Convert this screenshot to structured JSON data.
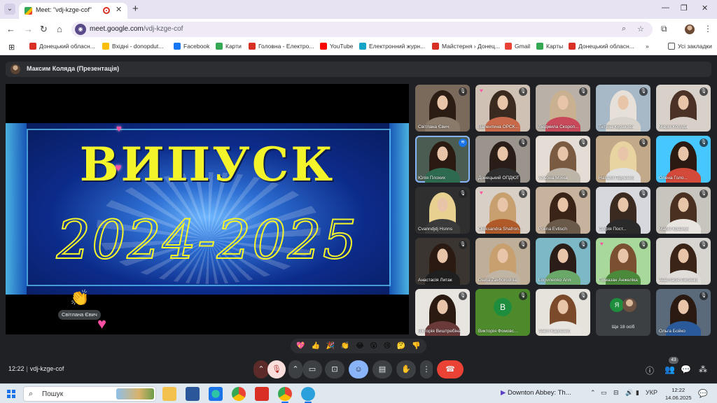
{
  "browser": {
    "tab_title": "Meet: \"vdj-kzge-cof\"",
    "new_tab": "+",
    "url_host": "meet.google.com",
    "url_path": "/vdj-kzge-cof",
    "bookmarks": [
      {
        "label": "Донецький обласн...",
        "color": "#d93025"
      },
      {
        "label": "Вхідні - donopdut...",
        "color": "#fbbc04"
      },
      {
        "label": "Facebook",
        "color": "#1877f2"
      },
      {
        "label": "Карти",
        "color": "#34a853"
      },
      {
        "label": "Головна - Електро...",
        "color": "#d93025"
      },
      {
        "label": "YouTube",
        "color": "#ff0000"
      },
      {
        "label": "Електронний журн...",
        "color": "#12a5c8"
      },
      {
        "label": "Майстерня › Донец...",
        "color": "#d93025"
      },
      {
        "label": "Gmail",
        "color": "#ea4335"
      },
      {
        "label": "Карты",
        "color": "#34a853"
      },
      {
        "label": "Донецький обласн...",
        "color": "#d93025"
      }
    ],
    "bookmarks_more": "»",
    "all_bookmarks": "Усі закладки"
  },
  "meet": {
    "presenter_label": "Максим Коляда (Презентація)",
    "slide": {
      "title": "ВИПУСК",
      "year": "2024-2025"
    },
    "reaction_name": "Світлана Євич",
    "tiles": [
      {
        "name": "Світлана Євич",
        "hair": "#2b1d14",
        "body": "#8a7a6a",
        "bg": "#7a6a5c",
        "mute": true
      },
      {
        "name": "Валентина ОРСК...",
        "hair": "#3a2a20",
        "body": "#c86a4a",
        "bg": "#cfc2b4",
        "mute": true,
        "heart": true
      },
      {
        "name": "Людмила Скороп...",
        "hair": "#c9b090",
        "body": "#c84a5a",
        "bg": "#b9b0a8",
        "mute": true
      },
      {
        "name": "Тетяна Куракова",
        "hair": "#e6e0d8",
        "body": "#d8d4cc",
        "bg": "#a7b8c6",
        "mute": true
      },
      {
        "name": "Марія Коляда",
        "hair": "#4a3326",
        "body": "#d8d0c8",
        "bg": "#d7d1c9",
        "mute": true
      },
      {
        "name": "Юлія Плохих",
        "hair": "#2a1a12",
        "body": "#2d6a4f",
        "bg": "#4b5d52",
        "speaking": true
      },
      {
        "name": "Донецький ОПДЮТ",
        "hair": "#2a1d18",
        "body": "#2f2f2f",
        "bg": "#9a948c",
        "mute": true
      },
      {
        "name": "Альона Міхна",
        "hair": "#7a5a40",
        "body": "#bdb5a8",
        "bg": "#e3ddd5",
        "mute": true
      },
      {
        "name": "Наталя Підченко",
        "hair": "#e8d4a0",
        "body": "#e0e0e0",
        "bg": "#c2a98a",
        "mute": true
      },
      {
        "name": "Олена Голо...",
        "hair": "#2a1a12",
        "body": "#d34a3a",
        "bg": "#47c7ff",
        "mute": true
      },
      {
        "name": "Сvanndjdj Hsnns",
        "hair": "#e8d090",
        "body": "#3a3a3a",
        "bg": "#2f2f2f",
        "mute": true
      },
      {
        "name": "Oleksandra Shafron...",
        "hair": "#c8a070",
        "body": "#b05a2a",
        "bg": "#d8d0c6",
        "mute": true,
        "heart": true
      },
      {
        "name": "Polina Evtisch",
        "hair": "#3a2418",
        "body": "#6a5a4a",
        "bg": "#c7b39d",
        "mute": true
      },
      {
        "name": "Софія Пост...",
        "hair": "#3a2a20",
        "body": "#2a2a2a",
        "bg": "#d6d8de",
        "mute": true
      },
      {
        "name": "Марія Кравчук",
        "hair": "#4a3020",
        "body": "#e8e4e0",
        "bg": "#c8c4be",
        "mute": true
      },
      {
        "name": "Анастасія Литак",
        "hair": "#2a1a12",
        "body": "#1f1f1f",
        "bg": "#3a3530",
        "mute": true
      },
      {
        "name": "Diana Zavhorodnia",
        "hair": "#c8a070",
        "body": "#c0b4a4",
        "bg": "#bfae98",
        "mute": true
      },
      {
        "name": "Logvinenko Ann",
        "hair": "#2a1d18",
        "body": "#6aa86a",
        "bg": "#7cb8c6",
        "mute": true
      },
      {
        "name": "Помазан Анжеліка",
        "hair": "#7a5030",
        "body": "#4a8a3a",
        "bg": "#a8d89a",
        "mute": true,
        "heart": true
      },
      {
        "name": "Анастасія Лисенко",
        "hair": "#3a2418",
        "body": "#e0dcd8",
        "bg": "#d8d4d0",
        "mute": true
      },
      {
        "name": "Вікторія Виштребіна",
        "hair": "#2a1a12",
        "body": "#6a3a3a",
        "bg": "#e8e4e0",
        "mute": true
      },
      {
        "name": "Викторія Фомовс...",
        "letter": "В",
        "bg": "#4d8a2c",
        "mute": true
      },
      {
        "name": "Анеті Карпенко",
        "hair": "#7a4a2a",
        "body": "#e8e4e0",
        "bg": "#e6e2dc",
        "mute": true
      },
      {
        "name": "Ще 18 осіб",
        "more": true
      },
      {
        "name": "Ольга Бойко",
        "hair": "#2a1a12",
        "body": "#2a5a9a",
        "bg": "#5a6a7a",
        "mute": true
      }
    ],
    "more_avatar_letter": "Я",
    "reactions": [
      "💖",
      "👍",
      "🎉",
      "👏",
      "😂",
      "😮",
      "😢",
      "🤔",
      "👎"
    ],
    "time": "12:22",
    "meeting_code": "vdj-kzge-cof",
    "participants_badge": "43"
  },
  "taskbar": {
    "search_placeholder": "Пошук",
    "media_title": "Downton Abbey: Th...",
    "language": "УКР",
    "time": "12:22",
    "date": "14.06.2025"
  }
}
